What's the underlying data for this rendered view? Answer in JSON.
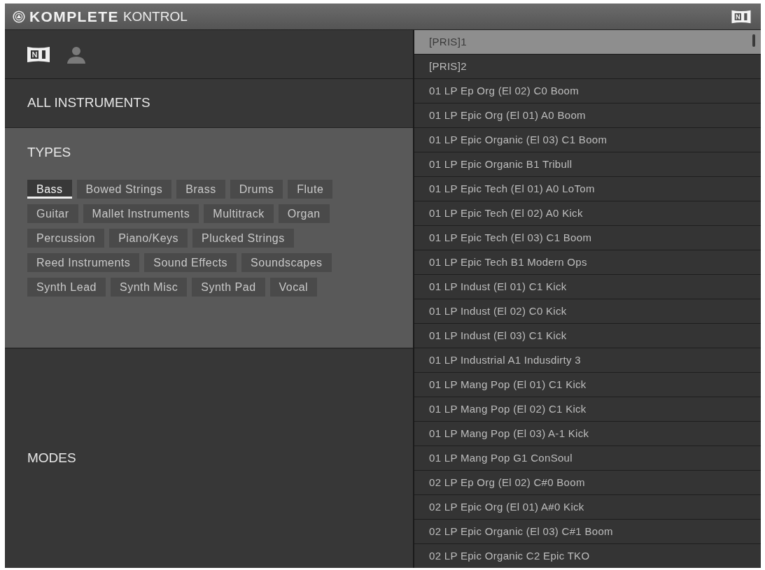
{
  "title_bar": {
    "brand_bold": "KOMPLETE",
    "brand_light": "KONTROL"
  },
  "sidebar": {
    "tabs": [
      {
        "kind": "ni",
        "selected": true
      },
      {
        "kind": "user",
        "selected": false
      }
    ],
    "all_instruments": {
      "label": "ALL INSTRUMENTS"
    },
    "types": {
      "title": "TYPES",
      "tags": [
        {
          "label": "Bass",
          "selected": true
        },
        {
          "label": "Bowed Strings",
          "selected": false
        },
        {
          "label": "Brass",
          "selected": false
        },
        {
          "label": "Drums",
          "selected": false
        },
        {
          "label": "Flute",
          "selected": false
        },
        {
          "label": "Guitar",
          "selected": false
        },
        {
          "label": "Mallet Instruments",
          "selected": false
        },
        {
          "label": "Multitrack",
          "selected": false
        },
        {
          "label": "Organ",
          "selected": false
        },
        {
          "label": "Percussion",
          "selected": false
        },
        {
          "label": "Piano/Keys",
          "selected": false
        },
        {
          "label": "Plucked Strings",
          "selected": false
        },
        {
          "label": "Reed Instruments",
          "selected": false
        },
        {
          "label": "Sound Effects",
          "selected": false
        },
        {
          "label": "Soundscapes",
          "selected": false
        },
        {
          "label": "Synth Lead",
          "selected": false
        },
        {
          "label": "Synth Misc",
          "selected": false
        },
        {
          "label": "Synth Pad",
          "selected": false
        },
        {
          "label": "Vocal",
          "selected": false
        }
      ]
    },
    "modes": {
      "label": "MODES"
    }
  },
  "presets": {
    "items": [
      {
        "label": "[PRIS]1",
        "selected": true
      },
      {
        "label": "[PRIS]2",
        "selected": false
      },
      {
        "label": "01 LP Ep Org (El 02) C0 Boom",
        "selected": false
      },
      {
        "label": "01 LP Epic Org (El 01) A0 Boom",
        "selected": false
      },
      {
        "label": "01 LP Epic Organic (El 03) C1 Boom",
        "selected": false
      },
      {
        "label": "01 LP Epic Organic B1 Tribull",
        "selected": false
      },
      {
        "label": "01 LP Epic Tech (El 01) A0 LoTom",
        "selected": false
      },
      {
        "label": "01 LP Epic Tech (El 02) A0 Kick",
        "selected": false
      },
      {
        "label": "01 LP Epic Tech (El 03) C1 Boom",
        "selected": false
      },
      {
        "label": "01 LP Epic Tech B1 Modern Ops",
        "selected": false
      },
      {
        "label": "01 LP Indust (El 01) C1 Kick",
        "selected": false
      },
      {
        "label": "01 LP Indust (El 02) C0 Kick",
        "selected": false
      },
      {
        "label": "01 LP Indust (El 03) C1 Kick",
        "selected": false
      },
      {
        "label": "01 LP Industrial A1 Indusdirty 3",
        "selected": false
      },
      {
        "label": "01 LP Mang Pop (El 01) C1 Kick",
        "selected": false
      },
      {
        "label": "01 LP Mang Pop (El 02) C1 Kick",
        "selected": false
      },
      {
        "label": "01 LP Mang Pop (El 03) A-1 Kick",
        "selected": false
      },
      {
        "label": "01 LP Mang Pop G1 ConSoul",
        "selected": false
      },
      {
        "label": "02 LP Ep Org (El 02) C#0 Boom",
        "selected": false
      },
      {
        "label": "02 LP Epic Org (El 01) A#0 Kick",
        "selected": false
      },
      {
        "label": "02 LP Epic Organic (El 03) C#1 Boom",
        "selected": false
      },
      {
        "label": "02 LP Epic Organic C2 Epic TKO",
        "selected": false
      }
    ]
  }
}
